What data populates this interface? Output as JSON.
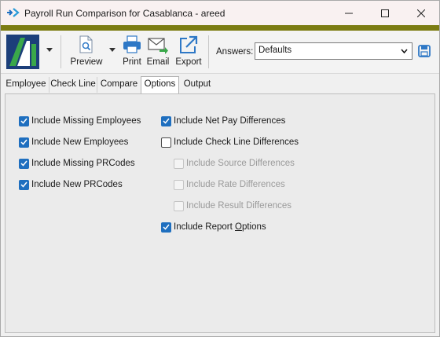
{
  "window": {
    "title": "Payroll Run Comparison for Casablanca - areed",
    "accent_color": "#7c7c12"
  },
  "toolbar": {
    "preview_label": "Preview",
    "print_label": "Print",
    "email_label": "Email",
    "export_label": "Export",
    "answers_label": "Answers:",
    "answers_value": "Defaults"
  },
  "tabs": [
    {
      "label": "Employee"
    },
    {
      "label": "Check Line"
    },
    {
      "label": "Compare"
    },
    {
      "label": "Options",
      "active": true
    },
    {
      "label": "Output"
    }
  ],
  "options": {
    "left": [
      {
        "label": "Include Missing Employees",
        "checked": true
      },
      {
        "label": "Include New Employees",
        "checked": true
      },
      {
        "label": "Include Missing PRCodes",
        "checked": true
      },
      {
        "label": "Include New PRCodes",
        "checked": true
      }
    ],
    "right": [
      {
        "label": "Include Net Pay Differences",
        "checked": true
      },
      {
        "label": "Include Check Line Differences",
        "checked": false
      },
      {
        "label": "Include Source Differences",
        "checked": false,
        "disabled": true
      },
      {
        "label": "Include Rate Differences",
        "checked": false,
        "disabled": true
      },
      {
        "label": "Include Result Differences",
        "checked": false,
        "disabled": true
      },
      {
        "label_pre": "Include Report ",
        "label_u": "O",
        "label_post": "ptions",
        "checked": true
      }
    ]
  },
  "colors": {
    "checkbox_checked": "#1f6fbf",
    "logo_green": "#3aa84a",
    "logo_blue": "#1c3f7a"
  }
}
